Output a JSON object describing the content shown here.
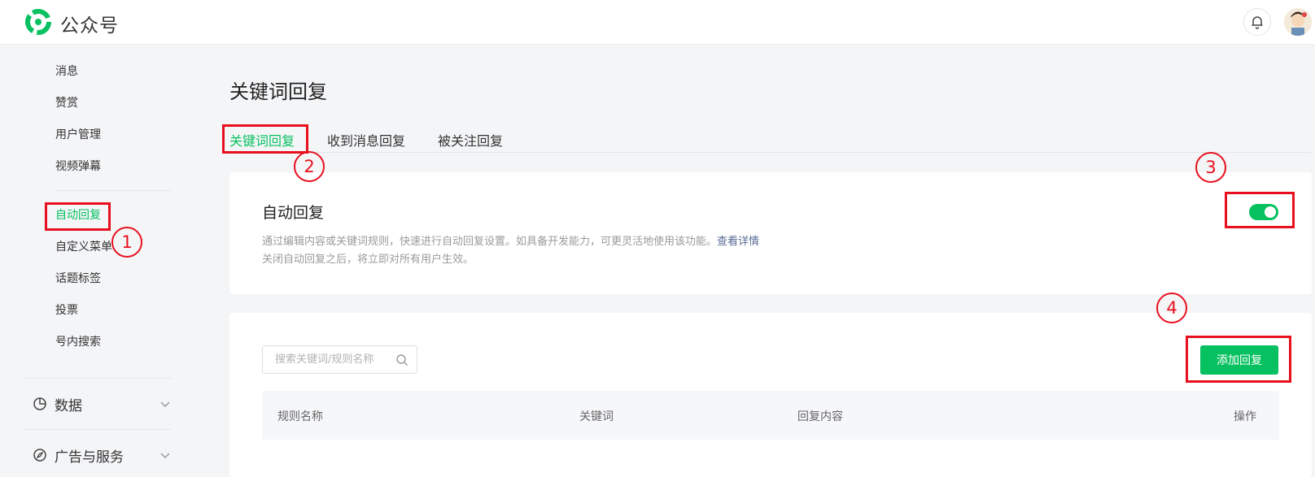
{
  "header": {
    "brand": "公众号"
  },
  "sidebar": {
    "items": [
      {
        "label": "消息"
      },
      {
        "label": "赞赏"
      },
      {
        "label": "用户管理"
      },
      {
        "label": "视频弹幕"
      },
      {
        "label": "自动回复",
        "active": true
      },
      {
        "label": "自定义菜单"
      },
      {
        "label": "话题标签"
      },
      {
        "label": "投票"
      },
      {
        "label": "号内搜索"
      }
    ],
    "groups": [
      {
        "label": "数据",
        "icon": "pie-chart-icon"
      },
      {
        "label": "广告与服务",
        "icon": "compass-icon"
      }
    ]
  },
  "main": {
    "title": "关键词回复",
    "tabs": [
      {
        "label": "关键词回复",
        "active": true
      },
      {
        "label": "收到消息回复"
      },
      {
        "label": "被关注回复"
      }
    ],
    "auto_reply": {
      "title": "自动回复",
      "desc_line1": "通过编辑内容或关键词规则，快速进行自动回复设置。如具备开发能力，可更灵活地使用该功能。",
      "desc_link": "查看详情",
      "desc_line2": "关闭自动回复之后，将立即对所有用户生效。",
      "enabled": true
    },
    "rules": {
      "search_placeholder": "搜索关键词/规则名称",
      "add_button": "添加回复",
      "columns": [
        "规则名称",
        "关键词",
        "回复内容",
        "操作"
      ]
    }
  },
  "annotations": {
    "labels": [
      "1",
      "2",
      "3",
      "4"
    ],
    "color": "#e8101e"
  },
  "colors": {
    "accent": "#07c160",
    "link": "#576b95"
  }
}
